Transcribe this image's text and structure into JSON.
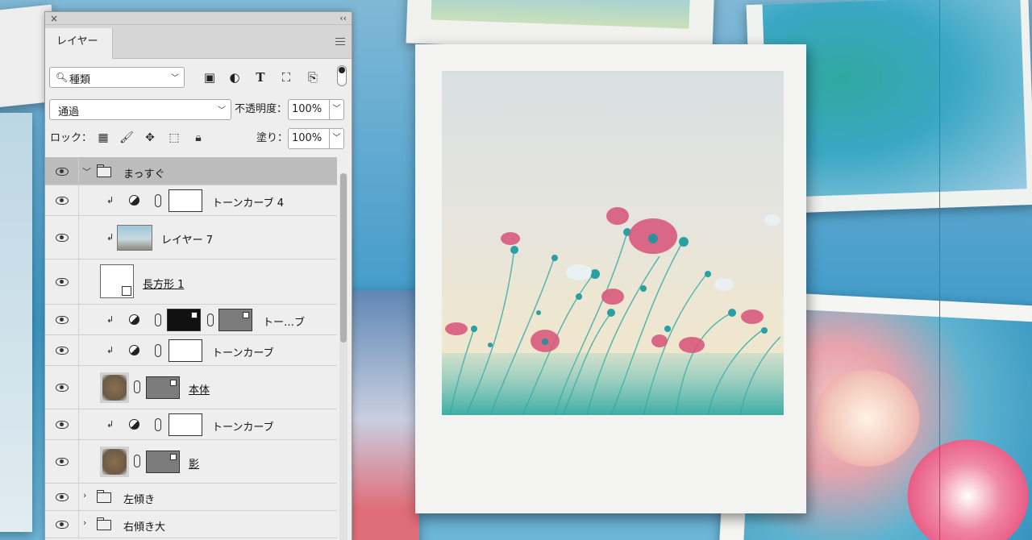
{
  "panel": {
    "tab_label": "レイヤー",
    "close_symbol": "×",
    "collapse_symbol": "‹‹",
    "filter": {
      "label": "種類",
      "icon": "search-icon"
    },
    "blend_mode": "通過",
    "opacity_label": "不透明度：",
    "opacity_value": "100%",
    "lock_label": "ロック：",
    "fill_label": "塗り：",
    "fill_value": "100%",
    "filter_icons": [
      "image-filter-icon",
      "adjustment-filter-icon",
      "type-filter-icon",
      "shape-filter-icon",
      "smart-object-filter-icon"
    ],
    "lock_icons": [
      "lock-transparent-icon",
      "lock-image-icon",
      "lock-position-icon",
      "lock-artboard-icon",
      "lock-all-icon"
    ]
  },
  "layers": [
    {
      "name": "まっすぐ",
      "kind": "group-open",
      "selected": true
    },
    {
      "name": "トーンカーブ 4",
      "kind": "adjustment"
    },
    {
      "name": "レイヤー 7",
      "kind": "image"
    },
    {
      "name": "長方形 1",
      "kind": "shape"
    },
    {
      "name": "トー…ブ",
      "kind": "adjustment-mask"
    },
    {
      "name": "トーンカーブ",
      "kind": "adjustment"
    },
    {
      "name": "本体",
      "kind": "smart"
    },
    {
      "name": "トーンカーブ",
      "kind": "adjustment"
    },
    {
      "name": "影",
      "kind": "smart"
    },
    {
      "name": "左傾き",
      "kind": "group-closed"
    },
    {
      "name": "右傾き大",
      "kind": "group-closed"
    }
  ],
  "colors": {
    "selected_row": "#bcbcbc",
    "panel_bg": "#eeeeee",
    "guide_line": "#e23a4a"
  }
}
